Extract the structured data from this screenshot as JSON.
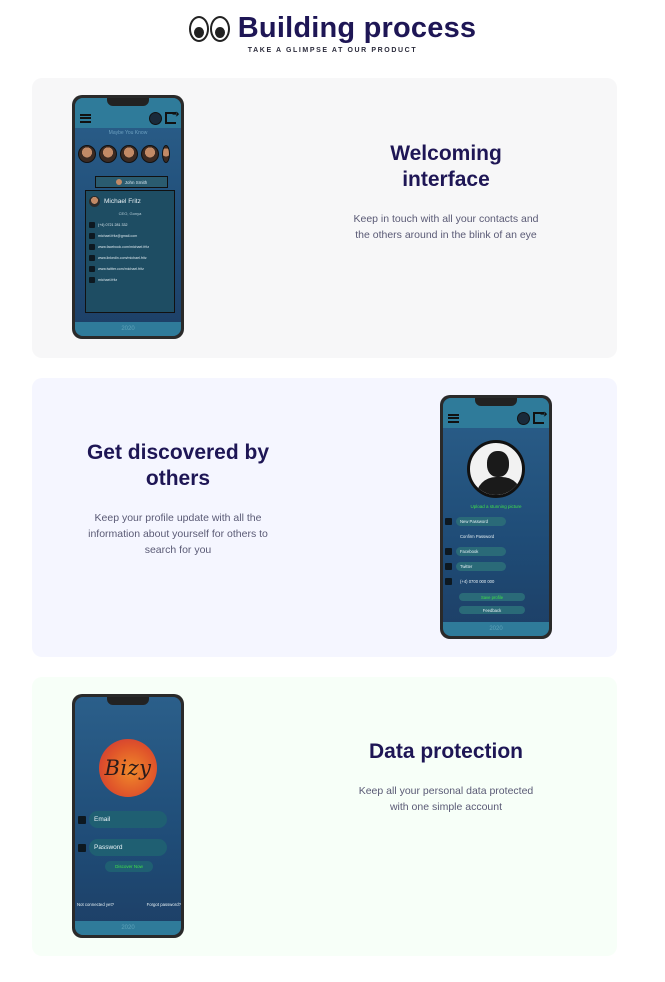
{
  "header": {
    "title": "Building process",
    "subtitle": "TAKE A GLIMPSE AT OUR PRODUCT"
  },
  "sections": [
    {
      "heading_line1": "Welcoming",
      "heading_line2": "interface",
      "desc_line1": "Keep in touch with all your contacts and",
      "desc_line2": "the others around in the blink of an eye",
      "background": "#f7f7f8"
    },
    {
      "heading_line1": "Get discovered by",
      "heading_line2": "others",
      "desc_line1": "Keep your profile update with all the",
      "desc_line2": "information about yourself for others to",
      "desc_line3": "search for you",
      "background": "#f5f6ff"
    },
    {
      "heading_line1": "Data protection",
      "desc_line1": "Keep all your personal data protected",
      "desc_line2": "with one simple account",
      "background": "#f7fff8"
    }
  ],
  "phone1": {
    "subtitle": "Maybe You Know",
    "chip_name": "John Smith",
    "card_name": "Michael Fritz",
    "card_role": "CEO, Gonya",
    "lines": [
      "(+4) 0721 281 332",
      "michael.fritz@gmail.com",
      "www.facebook.com/michael.fritz",
      "www.linkedin.com/michael.fritz",
      "www.twitter.com/michael.fritz",
      "michael.fritz"
    ],
    "footer": "2020"
  },
  "phone2": {
    "upload": "Upload a stunning picture",
    "fields": [
      "New Password",
      "Confirm Password",
      "Facebook",
      "Twitter",
      "(+4) 0700 000 000"
    ],
    "save": "Save profile",
    "feedback": "Feedback",
    "footer": "2020"
  },
  "phone3": {
    "logo": "Bizy",
    "email": "Email",
    "password": "Password",
    "discover": "Discover Now",
    "not_connected": "Not connected yet?",
    "forgot": "Forgot password?",
    "footer": "2020"
  },
  "colors": {
    "heading": "#1e1655",
    "body_text": "#5a5a75",
    "accent_green": "#3fe04a",
    "app_bar": "#2f7b9a"
  },
  "icons": [
    "eyes-icon",
    "hamburger-icon",
    "exit-icon",
    "phone-icon",
    "mail-icon",
    "facebook-icon",
    "linkedin-icon",
    "twitter-icon",
    "lock-icon",
    "user-icon"
  ]
}
